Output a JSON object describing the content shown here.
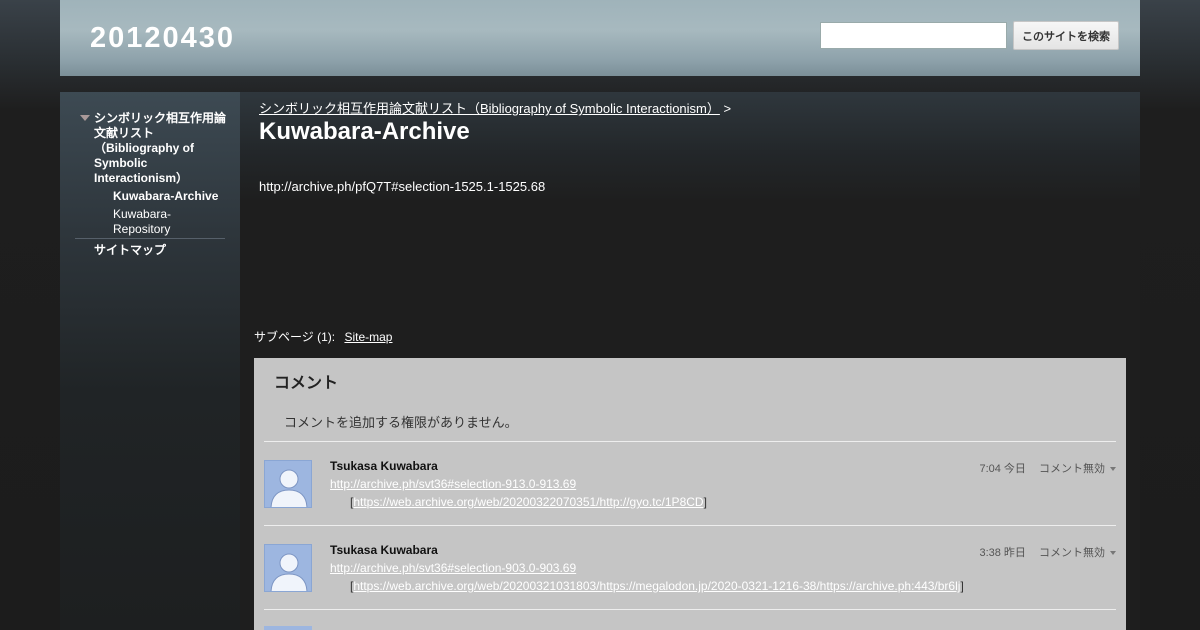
{
  "header": {
    "site_title": "20120430",
    "search_value": "",
    "search_button": "このサイトを検索"
  },
  "sidebar": {
    "main_item": "シンボリック相互作用論文献リスト（Bibliography of Symbolic Interactionism）",
    "sub_items": [
      "Kuwabara-Archive",
      "Kuwabara-Repository"
    ],
    "sitemap": "サイトマップ"
  },
  "content": {
    "breadcrumb_link": "シンボリック相互作用論文献リスト（Bibliography of Symbolic Interactionism）",
    "breadcrumb_sep": ">",
    "page_title": "Kuwabara-Archive",
    "body_text": "http://archive.ph/pfQ7T#selection-1525.1-1525.68",
    "subpages_label": "サブページ (1):",
    "subpages_link": "Site-map"
  },
  "comments": {
    "title": "コメント",
    "no_permission": "コメントを追加する権限がありません。",
    "items": [
      {
        "author": "Tsukasa Kuwabara",
        "link1": "http://archive.ph/svt36#selection-913.0-913.69",
        "bracket_open": "[",
        "link2": "https://web.archive.org/web/20200322070351/http://gyo.tc/1P8CD",
        "bracket_close": "]",
        "time": "7:04 今日",
        "action": "コメント無効"
      },
      {
        "author": "Tsukasa Kuwabara",
        "link1": "http://archive.ph/svt36#selection-903.0-903.69",
        "bracket_open": "[",
        "link2": "https://web.archive.org/web/20200321031803/https://megalodon.jp/2020-0321-1216-38/https://archive.ph:443/br6lj",
        "bracket_close": "]",
        "time": "3:38 昨日",
        "action": "コメント無効"
      }
    ]
  },
  "colors": {
    "header_accent": "#9fb3ba",
    "comments_bg": "#c5c5c5",
    "avatar_bg": "#9db6e0"
  }
}
